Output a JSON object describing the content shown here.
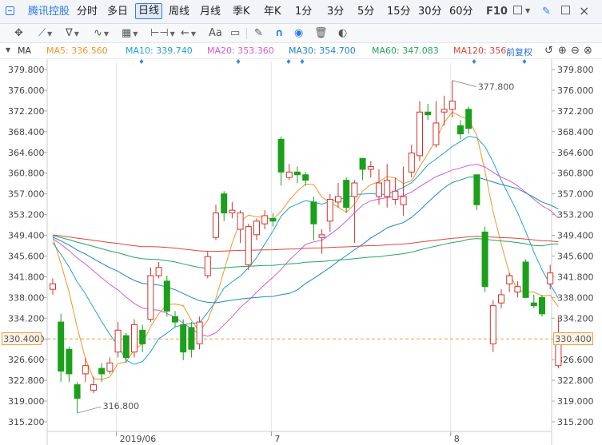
{
  "toolbar": {
    "logo_text": "腾讯控股",
    "periods": [
      "分时",
      "多日",
      "日线",
      "周线",
      "月线",
      "季K",
      "年K",
      "1分",
      "3分",
      "5分",
      "15分",
      "30分",
      "60分"
    ],
    "active_period": "日线",
    "f10": "F10"
  },
  "drawtools": {
    "text_tool": "Aa"
  },
  "ma_bar": {
    "name": "MA",
    "items": [
      {
        "label": "MA5: 336.560",
        "color": "#f0962a"
      },
      {
        "label": "MA10: 339.740",
        "color": "#1ea3d6"
      },
      {
        "label": "MA20: 353.360",
        "color": "#d45bd6"
      },
      {
        "label": "MA30: 354.700",
        "color": "#1c88c9"
      },
      {
        "label": "MA60: 347.083",
        "color": "#25a55e"
      },
      {
        "label": "MA120: 356.",
        "color": "#e0453a"
      }
    ],
    "adjust": "前复权"
  },
  "chart_data": {
    "type": "candlestick",
    "y_ticks": [
      "379.800",
      "376.000",
      "372.200",
      "368.400",
      "364.600",
      "360.800",
      "357.000",
      "353.200",
      "349.400",
      "345.600",
      "341.800",
      "338.000",
      "334.200",
      "330.400",
      "326.600",
      "322.800",
      "319.000",
      "315.200"
    ],
    "ylim": [
      315.2,
      379.8
    ],
    "x_labels": [
      "2019/06",
      "7",
      "8"
    ],
    "current_price": "330.400",
    "high_label": "377.800",
    "low_label": "316.800",
    "candles": [
      [
        339.5,
        340.5,
        341.5,
        338.5
      ],
      [
        333.5,
        324.5,
        335.0,
        322.5
      ],
      [
        328.5,
        324.0,
        329.0,
        322.5
      ],
      [
        322.0,
        319.5,
        322.5,
        316.8
      ],
      [
        324.0,
        325.5,
        327.0,
        322.5
      ],
      [
        321.0,
        322.0,
        323.5,
        320.5
      ],
      [
        325.0,
        324.0,
        326.0,
        322.5
      ],
      [
        324.5,
        326.0,
        327.0,
        324.0
      ],
      [
        328.0,
        332.0,
        333.5,
        327.0
      ],
      [
        331.0,
        327.0,
        331.5,
        326.0
      ],
      [
        328.0,
        333.0,
        334.0,
        327.0
      ],
      [
        332.0,
        329.5,
        333.0,
        328.0
      ],
      [
        334.0,
        342.0,
        343.5,
        333.5
      ],
      [
        342.0,
        343.5,
        344.5,
        341.5
      ],
      [
        341.0,
        335.5,
        342.0,
        334.5
      ],
      [
        334.5,
        333.5,
        335.5,
        332.5
      ],
      [
        333.0,
        328.0,
        334.0,
        326.5
      ],
      [
        332.5,
        328.5,
        333.5,
        327.0
      ],
      [
        329.5,
        333.5,
        334.5,
        328.5
      ],
      [
        342.0,
        345.5,
        346.5,
        341.5
      ],
      [
        349.0,
        353.5,
        355.0,
        348.5
      ],
      [
        357.0,
        353.5,
        357.5,
        352.0
      ],
      [
        353.5,
        354.0,
        355.5,
        352.5
      ],
      [
        350.5,
        353.5,
        354.0,
        348.0
      ],
      [
        344.0,
        351.0,
        351.5,
        343.0
      ],
      [
        349.5,
        352.0,
        352.5,
        348.5
      ],
      [
        351.5,
        353.0,
        354.0,
        350.5
      ],
      [
        352.5,
        352.0,
        353.5,
        351.0
      ],
      [
        367.0,
        361.0,
        367.5,
        358.5
      ],
      [
        360.0,
        361.0,
        362.5,
        359.5
      ],
      [
        361.0,
        360.5,
        362.0,
        359.0
      ],
      [
        360.5,
        359.5,
        361.0,
        358.5
      ],
      [
        355.5,
        351.5,
        356.5,
        348.5
      ],
      [
        349.0,
        349.5,
        350.5,
        346.0
      ],
      [
        352.0,
        356.0,
        357.0,
        350.0
      ],
      [
        355.5,
        356.5,
        359.0,
        354.5
      ],
      [
        359.5,
        354.5,
        360.0,
        353.5
      ],
      [
        356.5,
        359.0,
        359.5,
        348.0
      ],
      [
        363.5,
        361.5,
        363.5,
        359.5
      ],
      [
        361.5,
        362.0,
        363.0,
        360.0
      ],
      [
        356.5,
        359.0,
        361.5,
        355.0
      ],
      [
        356.5,
        359.5,
        362.5,
        354.5
      ],
      [
        356.0,
        357.5,
        360.0,
        355.0
      ],
      [
        355.0,
        356.5,
        362.0,
        353.0
      ],
      [
        361.0,
        364.5,
        366.0,
        360.0
      ],
      [
        364.0,
        372.0,
        374.0,
        363.0
      ],
      [
        372.0,
        371.5,
        373.5,
        370.5
      ],
      [
        366.0,
        370.0,
        374.0,
        365.5
      ],
      [
        372.0,
        372.5,
        375.0,
        369.5
      ],
      [
        372.5,
        374.0,
        377.8,
        371.0
      ],
      [
        369.5,
        368.0,
        370.5,
        367.0
      ],
      [
        372.5,
        369.0,
        373.0,
        368.0
      ],
      [
        360.5,
        355.0,
        360.5,
        354.0
      ],
      [
        350.0,
        340.0,
        351.0,
        339.0
      ],
      [
        329.5,
        336.5,
        337.5,
        328.0
      ],
      [
        337.0,
        338.5,
        339.5,
        336.0
      ],
      [
        340.5,
        342.0,
        342.5,
        339.0
      ],
      [
        339.0,
        340.0,
        341.0,
        338.0
      ],
      [
        344.5,
        338.0,
        345.0,
        338.0
      ],
      [
        337.0,
        336.5,
        338.5,
        336.0
      ],
      [
        338.0,
        335.0,
        338.5,
        334.5
      ],
      [
        340.5,
        342.5,
        344.0,
        339.5
      ],
      [
        325.5,
        329.5,
        334.5,
        325.0
      ]
    ]
  }
}
